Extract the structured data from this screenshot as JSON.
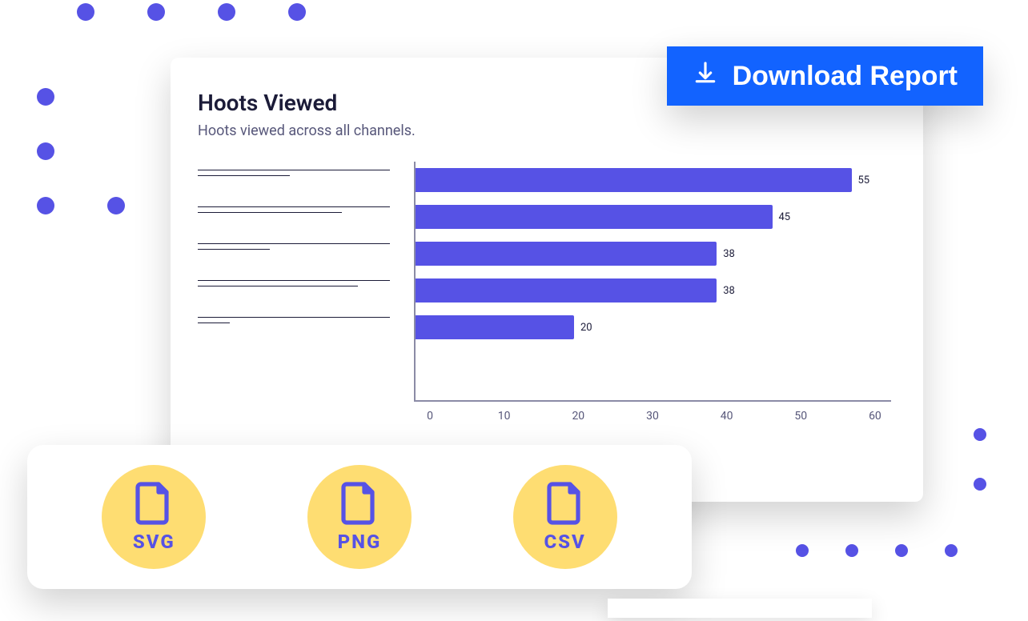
{
  "colors": {
    "primary_blue": "#1263ff",
    "bar_purple": "#5652e5",
    "accent_yellow": "#fedd72"
  },
  "chart_data": {
    "type": "bar",
    "orientation": "horizontal",
    "title": "Hoots Viewed",
    "subtitle": "Hoots viewed across all channels.",
    "xlabel": "",
    "ylabel": "",
    "xlim": [
      0,
      60
    ],
    "x_ticks": [
      0,
      10,
      20,
      30,
      40,
      50,
      60
    ],
    "categories": [
      "",
      "",
      "",
      "",
      ""
    ],
    "values": [
      55,
      45,
      38,
      38,
      20
    ]
  },
  "download_button": {
    "label": "Download Report"
  },
  "export_options": [
    {
      "format": "SVG"
    },
    {
      "format": "PNG"
    },
    {
      "format": "CSV"
    }
  ]
}
